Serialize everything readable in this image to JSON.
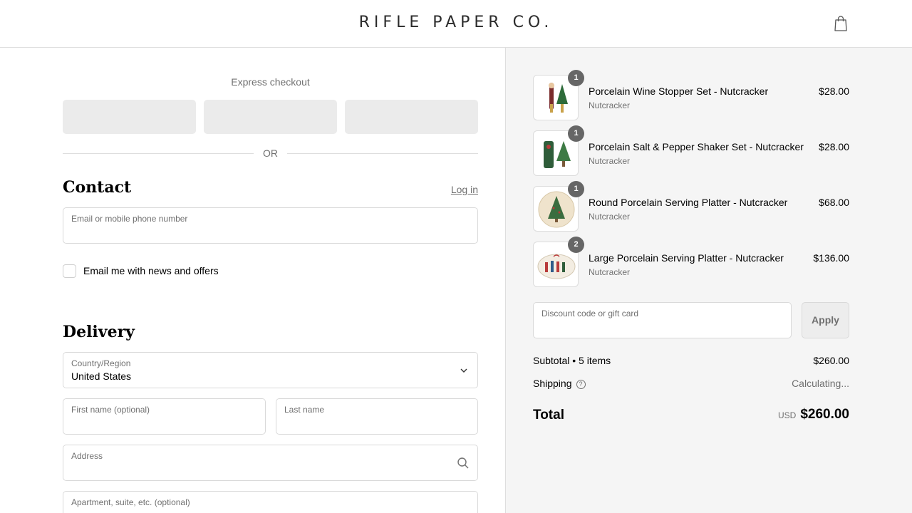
{
  "header": {
    "logo": "RIFLE PAPER CO.",
    "cart_icon": "shopping-bag-icon"
  },
  "express": {
    "title": "Express checkout",
    "or": "OR"
  },
  "contact": {
    "title": "Contact",
    "login": "Log in",
    "email_placeholder": "Email or mobile phone number",
    "news_label": "Email me with news and offers"
  },
  "delivery": {
    "title": "Delivery",
    "country_label": "Country/Region",
    "country_value": "United States",
    "first_name": "First name (optional)",
    "last_name": "Last name",
    "address": "Address",
    "apartment": "Apartment, suite, etc. (optional)"
  },
  "cart": {
    "items": [
      {
        "qty": "1",
        "name": "Porcelain Wine Stopper Set - Nutcracker",
        "variant": "Nutcracker",
        "price": "$28.00"
      },
      {
        "qty": "1",
        "name": "Porcelain Salt & Pepper Shaker Set - Nutcracker",
        "variant": "Nutcracker",
        "price": "$28.00"
      },
      {
        "qty": "1",
        "name": "Round Porcelain Serving Platter - Nutcracker",
        "variant": "Nutcracker",
        "price": "$68.00"
      },
      {
        "qty": "2",
        "name": "Large Porcelain Serving Platter - Nutcracker",
        "variant": "Nutcracker",
        "price": "$136.00"
      }
    ],
    "discount_placeholder": "Discount code or gift card",
    "apply": "Apply"
  },
  "summary": {
    "subtotal_label": "Subtotal • 5 items",
    "subtotal_value": "$260.00",
    "shipping_label": "Shipping",
    "shipping_value": "Calculating...",
    "total_label": "Total",
    "currency": "USD",
    "total_value": "$260.00"
  }
}
